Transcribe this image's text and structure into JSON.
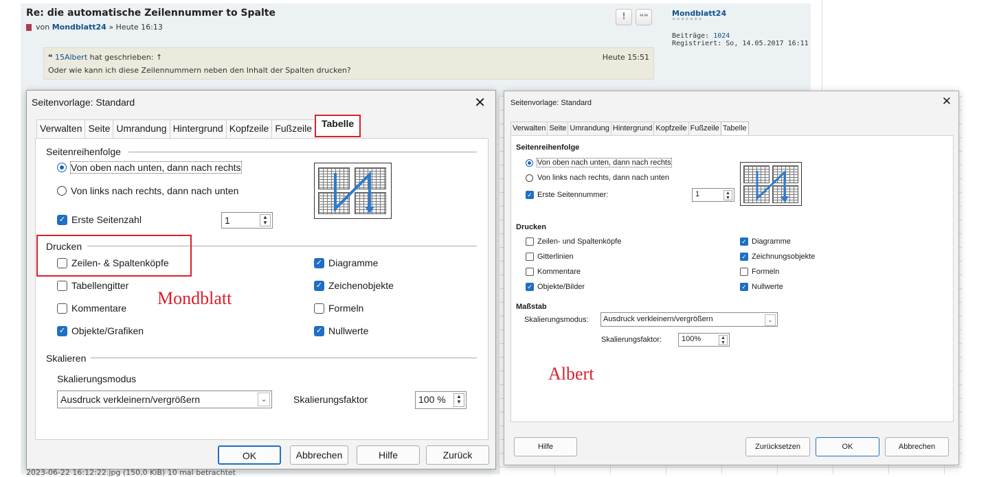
{
  "post": {
    "title": "Re: die automatische Zeilennummer to Spalte",
    "meta_prefix": "von",
    "author": "Mondblatt24",
    "meta_suffix": "» Heute 16:13",
    "btn_report": "!",
    "btn_quote": "❝❝"
  },
  "author_box": {
    "name": "Mondblatt24",
    "stars": "*******",
    "posts_label": "Beiträge:",
    "posts": "1024",
    "registered_label": "Registriert:",
    "registered": "So, 14.05.2017 16:11"
  },
  "quote": {
    "author": "15Albert",
    "wrote": "hat geschrieben: ↑",
    "time": "Heute 15:51",
    "text": "Oder wie kann ich diese Zeilennummern neben den Inhalt der Spalten drucken?"
  },
  "footer_text": "2023-06-22 16:12:22.jpg (150,0 KiB) 10 mal betrachtet",
  "left_dialog": {
    "title": "Seitenvorlage: Standard",
    "tabs": [
      "Verwalten",
      "Seite",
      "Umrandung",
      "Hintergrund",
      "Kopfzeile",
      "Fußzeile",
      "Tabelle"
    ],
    "section_order": "Seitenreihenfolge",
    "radio1": "Von oben nach unten, dann nach rechts",
    "radio2": "Von links nach rechts, dann nach unten",
    "first_page": "Erste Seitenzahl",
    "first_page_value": "1",
    "section_print": "Drucken",
    "print_left": [
      {
        "label": "Zeilen- & Spaltenköpfe",
        "checked": false
      },
      {
        "label": "Tabellengitter",
        "checked": false
      },
      {
        "label": "Kommentare",
        "checked": false
      },
      {
        "label": "Objekte/Grafiken",
        "checked": true
      }
    ],
    "print_right": [
      {
        "label": "Diagramme",
        "checked": true
      },
      {
        "label": "Zeichenobjekte",
        "checked": true
      },
      {
        "label": "Formeln",
        "checked": false
      },
      {
        "label": "Nullwerte",
        "checked": true
      }
    ],
    "section_scale": "Skalieren",
    "scale_mode_label": "Skalierungsmodus",
    "scale_mode_value": "Ausdruck verkleinern/vergrößern",
    "scale_factor_label": "Skalierungsfaktor",
    "scale_factor_value": "100 %",
    "buttons": {
      "ok": "OK",
      "cancel": "Abbrechen",
      "help": "Hilfe",
      "back": "Zurück"
    },
    "annotation": "Mondblatt"
  },
  "right_dialog": {
    "title": "Seitenvorlage: Standard",
    "tabs": [
      "Verwalten",
      "Seite",
      "Umrandung",
      "Hintergrund",
      "Kopfzeile",
      "Fußzeile",
      "Tabelle"
    ],
    "section_order": "Seitenreihenfolge",
    "radio1": "Von oben nach unten, dann nach rechts",
    "radio2": "Von links nach rechts, dann nach unten",
    "first_page": "Erste Seitennummer:",
    "first_page_value": "1",
    "section_print": "Drucken",
    "print_left": [
      {
        "label": "Zeilen- und Spaltenköpfe",
        "checked": false
      },
      {
        "label": "Gitterlinien",
        "checked": false
      },
      {
        "label": "Kommentare",
        "checked": false
      },
      {
        "label": "Objekte/Bilder",
        "checked": true
      }
    ],
    "print_right": [
      {
        "label": "Diagramme",
        "checked": true
      },
      {
        "label": "Zeichnungsobjekte",
        "checked": true
      },
      {
        "label": "Formeln",
        "checked": false
      },
      {
        "label": "Nullwerte",
        "checked": true
      }
    ],
    "section_scale": "Maßstab",
    "scale_mode_label": "Skalierungsmodus:",
    "scale_mode_value": "Ausdruck verkleinern/vergrößern",
    "scale_factor_label": "Skalierungsfaktor:",
    "scale_factor_value": "100%",
    "buttons": {
      "help": "Hilfe",
      "reset": "Zurücksetzen",
      "ok": "OK",
      "cancel": "Abbrechen"
    },
    "annotation": "Albert"
  }
}
